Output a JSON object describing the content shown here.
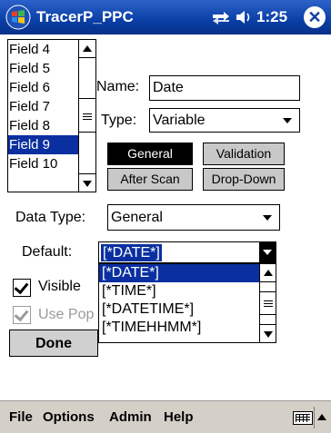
{
  "titlebar": {
    "title": "TracerP_PPC",
    "time": "1:25",
    "close_label": "✕",
    "icons": [
      "start-menu-logo",
      "connectivity-icon",
      "volume-icon",
      "close-icon"
    ]
  },
  "field_list": {
    "items": [
      "Field 4",
      "Field 5",
      "Field 6",
      "Field 7",
      "Field 8",
      "Field 9",
      "Field 10"
    ],
    "selected": "Field 9"
  },
  "form": {
    "name_label": "Name:",
    "name_value": "Date",
    "type_label": "Type:",
    "type_value": "Variable",
    "data_type_label": "Data Type:",
    "data_type_value": "General",
    "default_label": "Default:",
    "default_value": "[*DATE*]"
  },
  "tabs": {
    "general": "General",
    "validation": "Validation",
    "after_scan": "After Scan",
    "drop_down": "Drop-Down",
    "active": "General"
  },
  "default_dropdown": {
    "options": [
      "[*DATE*]",
      "[*TIME*]",
      "[*DATETIME*]",
      "[*TIMEHHMM*]"
    ],
    "selected": "[*DATE*]"
  },
  "checkboxes": {
    "visible": {
      "label": "Visible",
      "checked": true
    },
    "use_popup": {
      "label": "Use Pop",
      "checked": true,
      "disabled": true
    }
  },
  "done_label": "Done",
  "menubar": {
    "file": "File",
    "options": "Options",
    "admin": "Admin",
    "help": "Help"
  },
  "colors": {
    "titlebar": "#0a3fa6",
    "selection": "#0a2fa0",
    "menubar": "#d4d0c8",
    "button_gray": "#c8c8c8"
  }
}
